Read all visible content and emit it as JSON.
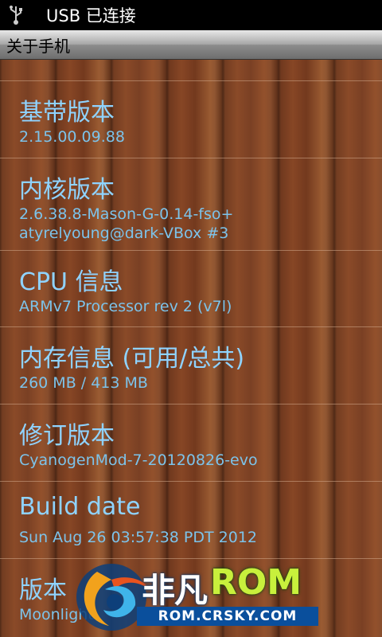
{
  "status_bar": {
    "icon": "usb-icon",
    "text": "USB 已连接"
  },
  "title_bar": {
    "title": "关于手机"
  },
  "items": [
    {
      "title": "基带版本",
      "value": "2.15.00.09.88"
    },
    {
      "title": "内核版本",
      "value_lines": [
        "2.6.38.8-Mason-G-0.14-fso+",
        "atyrelyoung@dark-VBox #3"
      ]
    },
    {
      "title": "CPU 信息",
      "value": " ARMv7 Processor rev 2 (v7l)"
    },
    {
      "title": "内存信息 (可用/总共)",
      "value": "260 MB / 413 MB"
    },
    {
      "title": "修订版本",
      "value": "CyanogenMod-7-20120826-evo"
    },
    {
      "title": "Build date",
      "value": "Sun Aug 26 03:57:38 PDT 2012"
    },
    {
      "title": "版本",
      "value": "Moonlight"
    }
  ],
  "watermark": {
    "brand_cn": "非凡",
    "brand_en": "ROM",
    "url": "ROM.CRSKY.COM"
  },
  "colors": {
    "title_text": "#8fd3ff",
    "value_text": "#7cc3ea",
    "status_bg": "#000000"
  }
}
